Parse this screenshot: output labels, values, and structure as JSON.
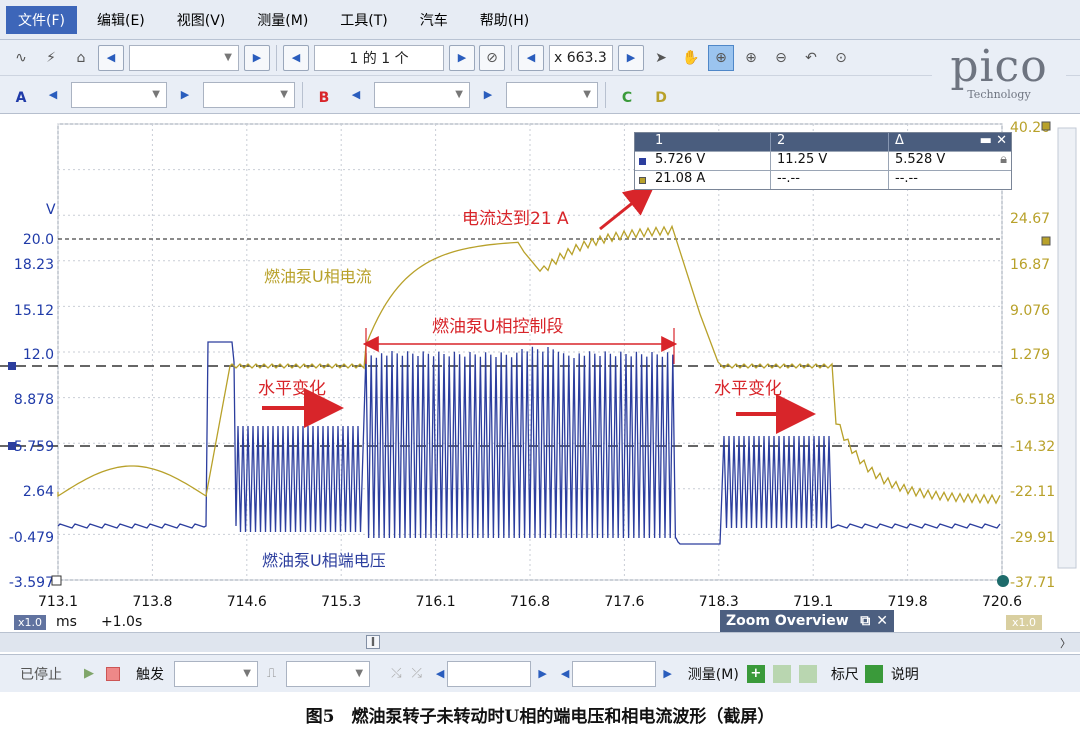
{
  "menu": {
    "file": "文件(F)",
    "edit": "编辑(E)",
    "view": "视图(V)",
    "measure": "测量(M)",
    "tools": "工具(T)",
    "auto": "汽车",
    "help": "帮助(H)"
  },
  "toolbar1": {
    "buffer_label": "1 的 1 个",
    "zoom_value": "x 663.3"
  },
  "toolbar2": {
    "ch_a": "A",
    "ch_b": "B",
    "ch_c": "C",
    "ch_d": "D"
  },
  "logo": {
    "main": "pico",
    "sub": "Technology"
  },
  "axes": {
    "left_unit": "V",
    "left_ticks": [
      "20.0",
      "18.23",
      "15.12",
      "12.0",
      "8.878",
      "5.759",
      "2.64",
      "-0.479",
      "-3.597"
    ],
    "right_ticks": [
      "40.26",
      "24.67",
      "16.87",
      "9.076",
      "1.279",
      "-6.518",
      "-14.32",
      "-22.11",
      "-29.91",
      "-37.71"
    ],
    "x_ticks": [
      "713.1",
      "713.8",
      "714.6",
      "715.3",
      "716.1",
      "716.8",
      "717.6",
      "718.3",
      "719.1",
      "719.8",
      "720.6"
    ],
    "x_unit": "ms",
    "x_zoom_badge": "x1.0",
    "x_offset": "+1.0s",
    "right_zoom_badge": "x1.0"
  },
  "measurements": {
    "headers": [
      "1",
      "2",
      "Δ"
    ],
    "rows": [
      {
        "v1": "5.726 V",
        "v2": "11.25 V",
        "delta": "5.528 V",
        "color": "#2c3e9e"
      },
      {
        "v1": "21.08 A",
        "v2": "--.--",
        "delta": "--.--",
        "color": "#b8a12a"
      }
    ]
  },
  "annotations": {
    "current_peak": "电流达到21 A",
    "current_label": "燃油泵U相电流",
    "control_segment": "燃油泵U相控制段",
    "level_change_left": "水平变化",
    "level_change_right": "水平变化",
    "voltage_label": "燃油泵U相端电压"
  },
  "zoom_overview": {
    "title": "Zoom Overview"
  },
  "statusbar": {
    "stopped": "已停止",
    "trigger": "触发",
    "measure": "测量(M)",
    "ruler": "标尺",
    "notes": "说明"
  },
  "caption": "图5　燃油泵转子未转动时U相的端电压和相电流波形（截屏）",
  "colors": {
    "voltage": "#2c3e9e",
    "current": "#b8a12a",
    "annotation": "#d8252a"
  }
}
